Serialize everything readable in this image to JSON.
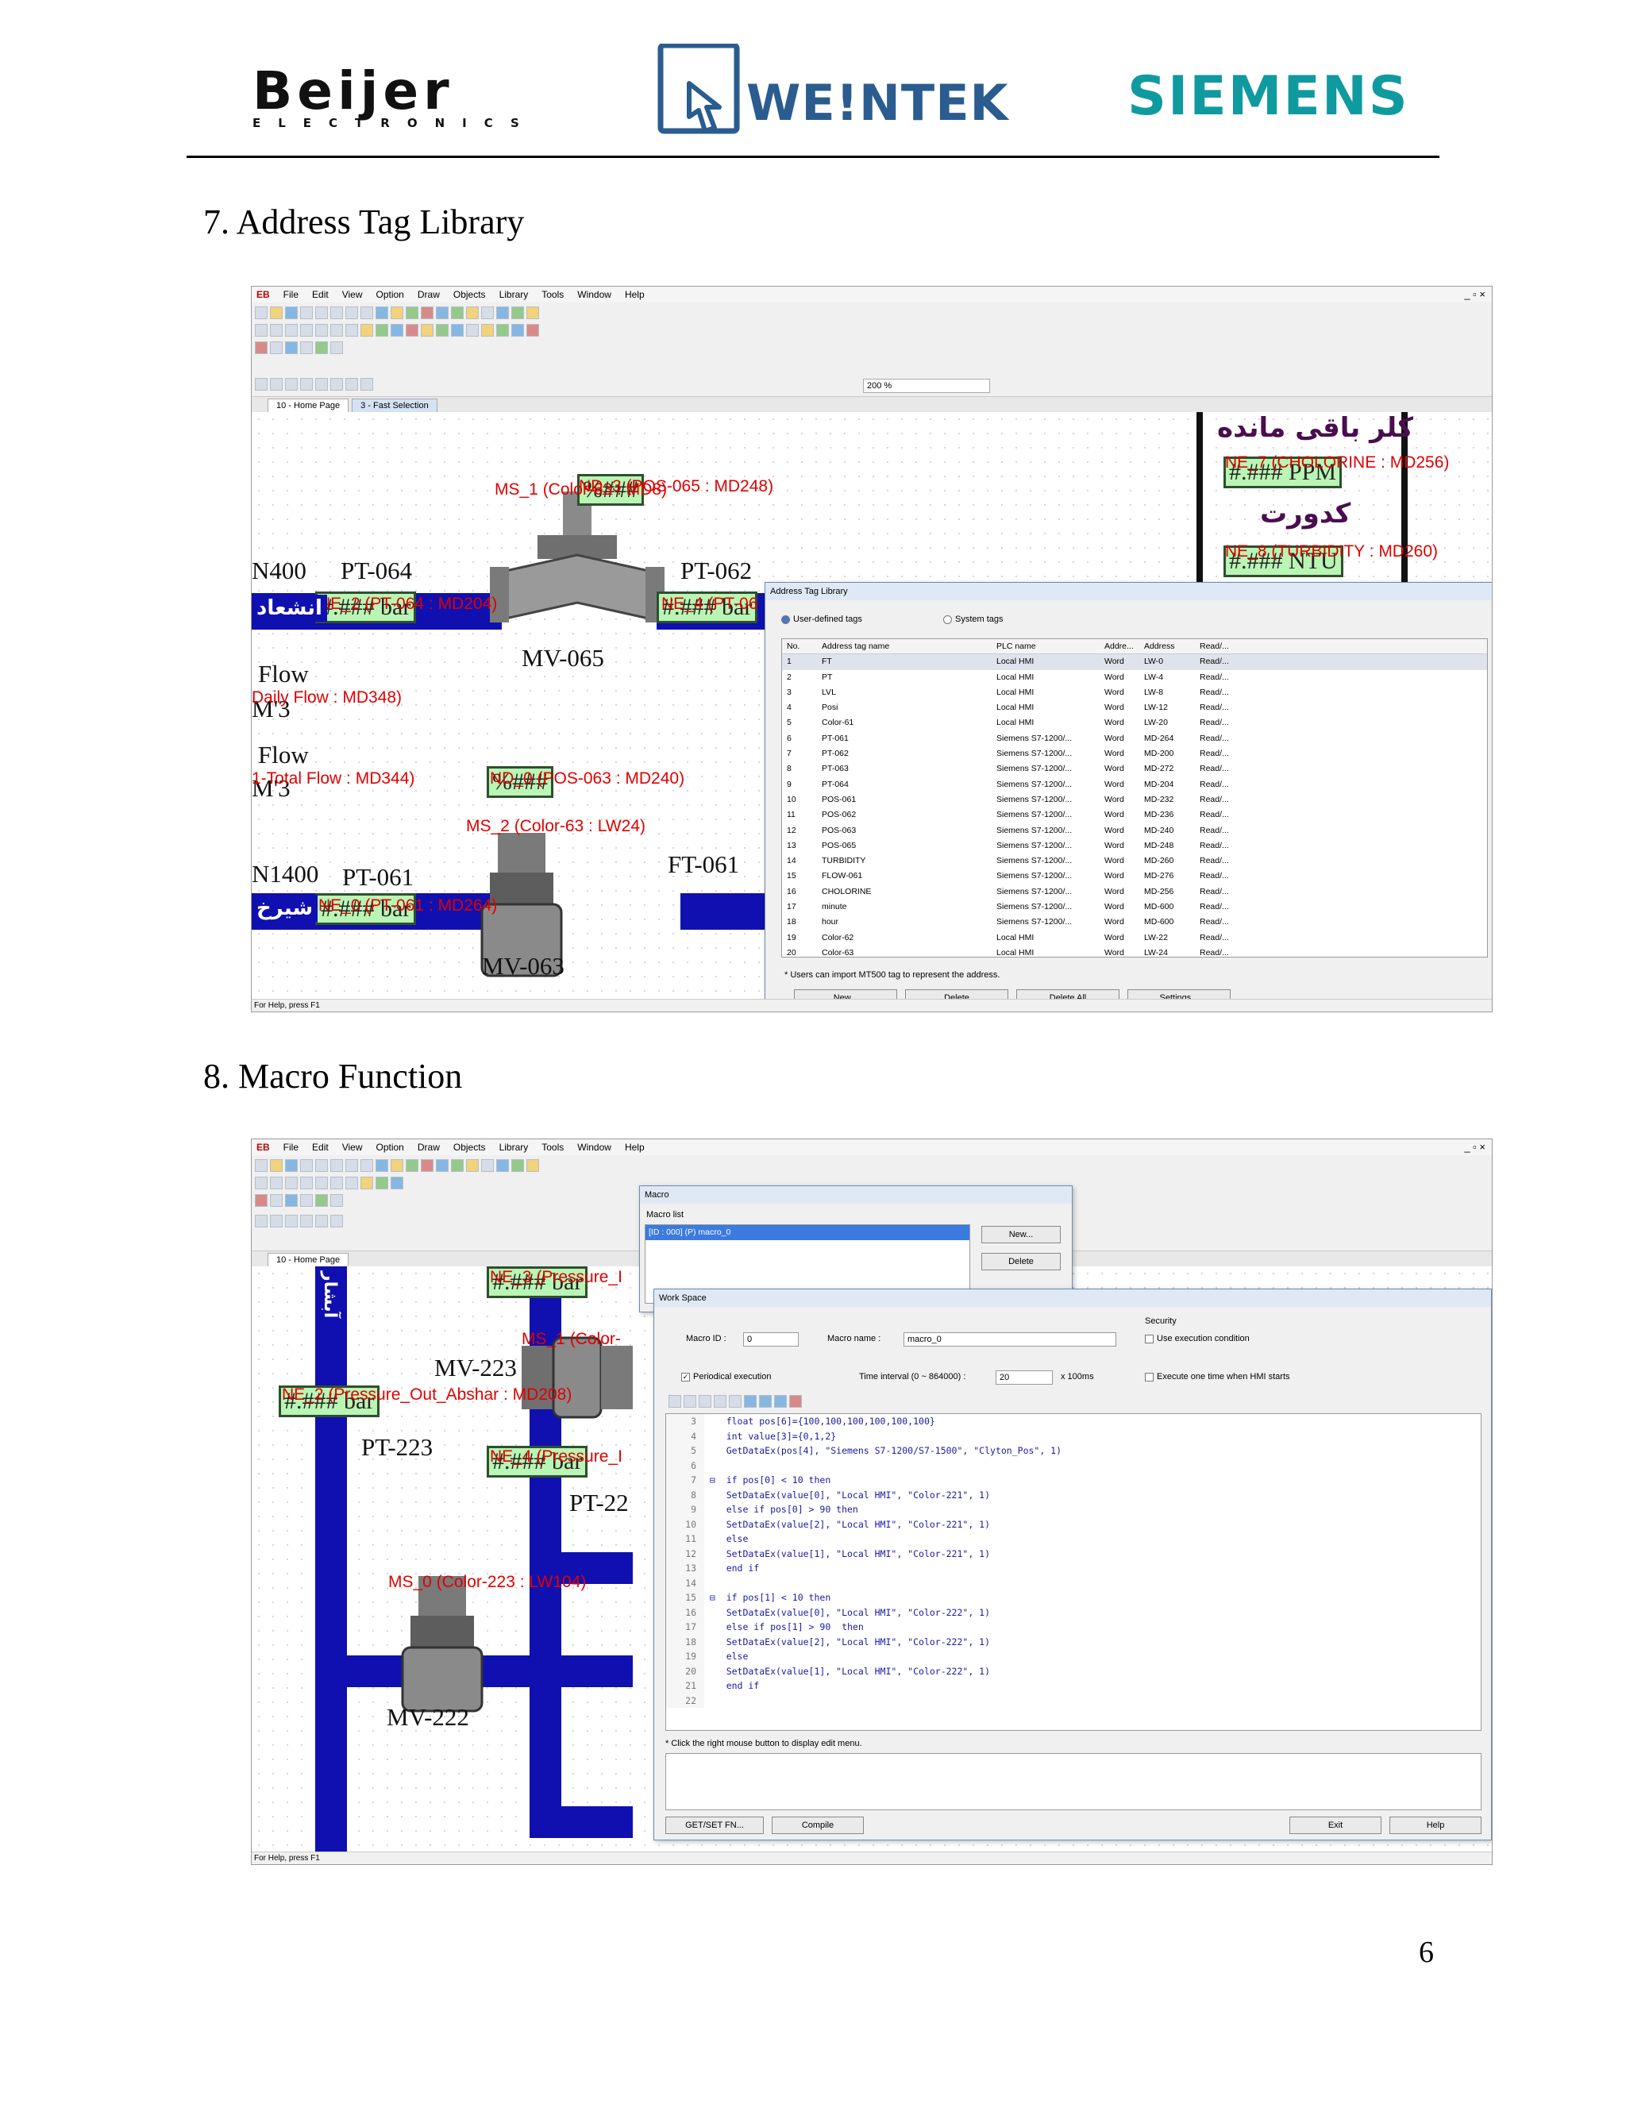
{
  "header": {
    "beijer_main": "Beijer",
    "beijer_sub": "ELECTRONICS",
    "weintek": "WE!NTEK",
    "siemens": "SIEMENS"
  },
  "section7": {
    "title": "7.  Address Tag Library"
  },
  "section8": {
    "title": "8.  Macro Function"
  },
  "page_number": "6",
  "app": {
    "logo": "EB",
    "menu": [
      "File",
      "Edit",
      "View",
      "Option",
      "Draw",
      "Objects",
      "Library",
      "Tools",
      "Window",
      "Help"
    ],
    "window_controls": "_ ▫ ×",
    "zoom": "200 %",
    "status_help": "For Help, press F1"
  },
  "shot1": {
    "tabs": [
      "10 - Home Page",
      "3 - Fast Selection"
    ],
    "labels": {
      "n400": "N400",
      "pt064": "PT-064",
      "pt062": "PT-062",
      "mv065": "MV-065",
      "flow1": "Flow",
      "flow2": "Flow",
      "mv3a": "M'3",
      "mv3b": "M'3",
      "n1400": "N1400",
      "pt061": "PT-061",
      "ft061": "FT-061",
      "mv063": "MV-063"
    },
    "tags": {
      "ms1": "MS_1 (Color-63 : MD8)",
      "nd3": "ND_3 (POS-065 : MD248)",
      "ne2": "NE_2 (PT-064 : MD204)",
      "ne4": "NE_4 (PT-06",
      "daily_flow": "Daily Flow : MD348)",
      "total_flow": "1-Total Flow : MD344)",
      "nd0": "ND_0 (POS-063 : MD240)",
      "ms2": "MS_2 (Color-63 : LW24)",
      "ne0": "NE_0 (PT-061 : MD264)",
      "ne7": "NE_7 (CHOLORINE : MD256)",
      "ne8": "NE_8 (TURBIDITY : MD260)"
    },
    "displays": {
      "d1": "#.### bar",
      "d2": "#.### bar",
      "d3": "#.### bar",
      "d4": "%###",
      "d5": "%###",
      "ppm": "#.### PPM",
      "ntu": "#.### NTU"
    },
    "arabic": {
      "a1": "انشعاد",
      "a2": "شیرخ",
      "a3": "کلر باقی مانده",
      "a4": "کدورت"
    },
    "dialog": {
      "title": "Address Tag Library",
      "radio_user": "User-defined tags",
      "radio_system": "System tags",
      "columns": [
        "No.",
        "Address tag name",
        "PLC name",
        "Addre...",
        "Address",
        "Read/..."
      ],
      "rows": [
        [
          "1",
          "FT",
          "Local HMI",
          "Word",
          "LW-0",
          "Read/..."
        ],
        [
          "2",
          "PT",
          "Local HMI",
          "Word",
          "LW-4",
          "Read/..."
        ],
        [
          "3",
          "LVL",
          "Local HMI",
          "Word",
          "LW-8",
          "Read/..."
        ],
        [
          "4",
          "Posi",
          "Local HMI",
          "Word",
          "LW-12",
          "Read/..."
        ],
        [
          "5",
          "Color-61",
          "Local HMI",
          "Word",
          "LW-20",
          "Read/..."
        ],
        [
          "6",
          "PT-061",
          "Siemens S7-1200/...",
          "Word",
          "MD-264",
          "Read/..."
        ],
        [
          "7",
          "PT-062",
          "Siemens S7-1200/...",
          "Word",
          "MD-200",
          "Read/..."
        ],
        [
          "8",
          "PT-063",
          "Siemens S7-1200/...",
          "Word",
          "MD-272",
          "Read/..."
        ],
        [
          "9",
          "PT-064",
          "Siemens S7-1200/...",
          "Word",
          "MD-204",
          "Read/..."
        ],
        [
          "10",
          "POS-061",
          "Siemens S7-1200/...",
          "Word",
          "MD-232",
          "Read/..."
        ],
        [
          "11",
          "POS-062",
          "Siemens S7-1200/...",
          "Word",
          "MD-236",
          "Read/..."
        ],
        [
          "12",
          "POS-063",
          "Siemens S7-1200/...",
          "Word",
          "MD-240",
          "Read/..."
        ],
        [
          "13",
          "POS-065",
          "Siemens S7-1200/...",
          "Word",
          "MD-248",
          "Read/..."
        ],
        [
          "14",
          "TURBIDITY",
          "Siemens S7-1200/...",
          "Word",
          "MD-260",
          "Read/..."
        ],
        [
          "15",
          "FLOW-061",
          "Siemens S7-1200/...",
          "Word",
          "MD-276",
          "Read/..."
        ],
        [
          "16",
          "CHOLORINE",
          "Siemens S7-1200/...",
          "Word",
          "MD-256",
          "Read/..."
        ],
        [
          "17",
          "minute",
          "Siemens S7-1200/...",
          "Word",
          "MD-600",
          "Read/..."
        ],
        [
          "18",
          "hour",
          "Siemens S7-1200/...",
          "Word",
          "MD-600",
          "Read/..."
        ],
        [
          "19",
          "Color-62",
          "Local HMI",
          "Word",
          "LW-22",
          "Read/..."
        ],
        [
          "20",
          "Color-63",
          "Local HMI",
          "Word",
          "LW-24",
          "Read/..."
        ]
      ],
      "note": "* Users can import MT500 tag to represent the address.",
      "buttons": [
        "New...",
        "Delete",
        "Delete All",
        "Settings..."
      ]
    }
  },
  "shot2": {
    "tabs": [
      "10 - Home Page"
    ],
    "labels": {
      "mv223": "MV-223",
      "pt223": "PT-223",
      "pt22x": "PT-22",
      "mv222": "MV-222"
    },
    "tags": {
      "ne3": "NE_3 (Pressure_I",
      "ms1": "MS_1 (Color-",
      "ne2": "NE_2 (Pressure_Out_Abshar : MD208)",
      "ne4": "NE_4 (Pressure_I",
      "ms0": "MS_0 (Color-223 : LW104)"
    },
    "displays": {
      "d1": "#.### bar",
      "d2": "#.### bar",
      "d3": "#.### bar"
    },
    "arabic": {
      "a1": "آبشار"
    },
    "macro": {
      "title": "Macro",
      "macro_list_label": "Macro list",
      "list_item": "[ID : 000] (P)      macro_0",
      "btn_new": "New...",
      "btn_delete": "Delete",
      "workspace_title": "Work Space",
      "macro_id_label": "Macro ID :",
      "macro_id": "0",
      "macro_name_label": "Macro name :",
      "macro_name": "macro_0",
      "security_label": "Security",
      "use_exec_cond": "Use execution condition",
      "periodical": "Periodical execution",
      "time_interval_label": "Time interval (0 ~ 864000) :",
      "time_interval": "20",
      "time_unit": "x 100ms",
      "exec_once": "Execute one time when HMI starts",
      "code": [
        [
          "3",
          "    float pos[6]={100,100,100,100,100,100}"
        ],
        [
          "4",
          "    int value[3]={0,1,2}"
        ],
        [
          "5",
          "    GetDataEx(pos[4], \"Siemens S7-1200/S7-1500\", \"Clyton_Pos\", 1)"
        ],
        [
          "6",
          ""
        ],
        [
          "7",
          " ⊟  if pos[0] < 10 then"
        ],
        [
          "8",
          "    SetDataEx(value[0], \"Local HMI\", \"Color-221\", 1)"
        ],
        [
          "9",
          "    else if pos[0] > 90 then"
        ],
        [
          "10",
          "    SetDataEx(value[2], \"Local HMI\", \"Color-221\", 1)"
        ],
        [
          "11",
          "    else"
        ],
        [
          "12",
          "    SetDataEx(value[1], \"Local HMI\", \"Color-221\", 1)"
        ],
        [
          "13",
          "    end if"
        ],
        [
          "14",
          ""
        ],
        [
          "15",
          " ⊟  if pos[1] < 10 then"
        ],
        [
          "16",
          "    SetDataEx(value[0], \"Local HMI\", \"Color-222\", 1)"
        ],
        [
          "17",
          "    else if pos[1] > 90  then"
        ],
        [
          "18",
          "    SetDataEx(value[2], \"Local HMI\", \"Color-222\", 1)"
        ],
        [
          "19",
          "    else"
        ],
        [
          "20",
          "    SetDataEx(value[1], \"Local HMI\", \"Color-222\", 1)"
        ],
        [
          "21",
          "    end if"
        ],
        [
          "22",
          ""
        ]
      ],
      "hint": "* Click the right mouse button to display edit menu.",
      "btn_getset": "GET/SET FN...",
      "btn_compile": "Compile",
      "btn_exit": "Exit",
      "btn_help": "Help"
    }
  },
  "colors": {
    "pipe": "#1010b0",
    "tag_red": "#e00000",
    "display_green": "#b9f5b4",
    "weintek_blue": "#2a5c8f",
    "siemens_teal": "#0f9aa0"
  }
}
